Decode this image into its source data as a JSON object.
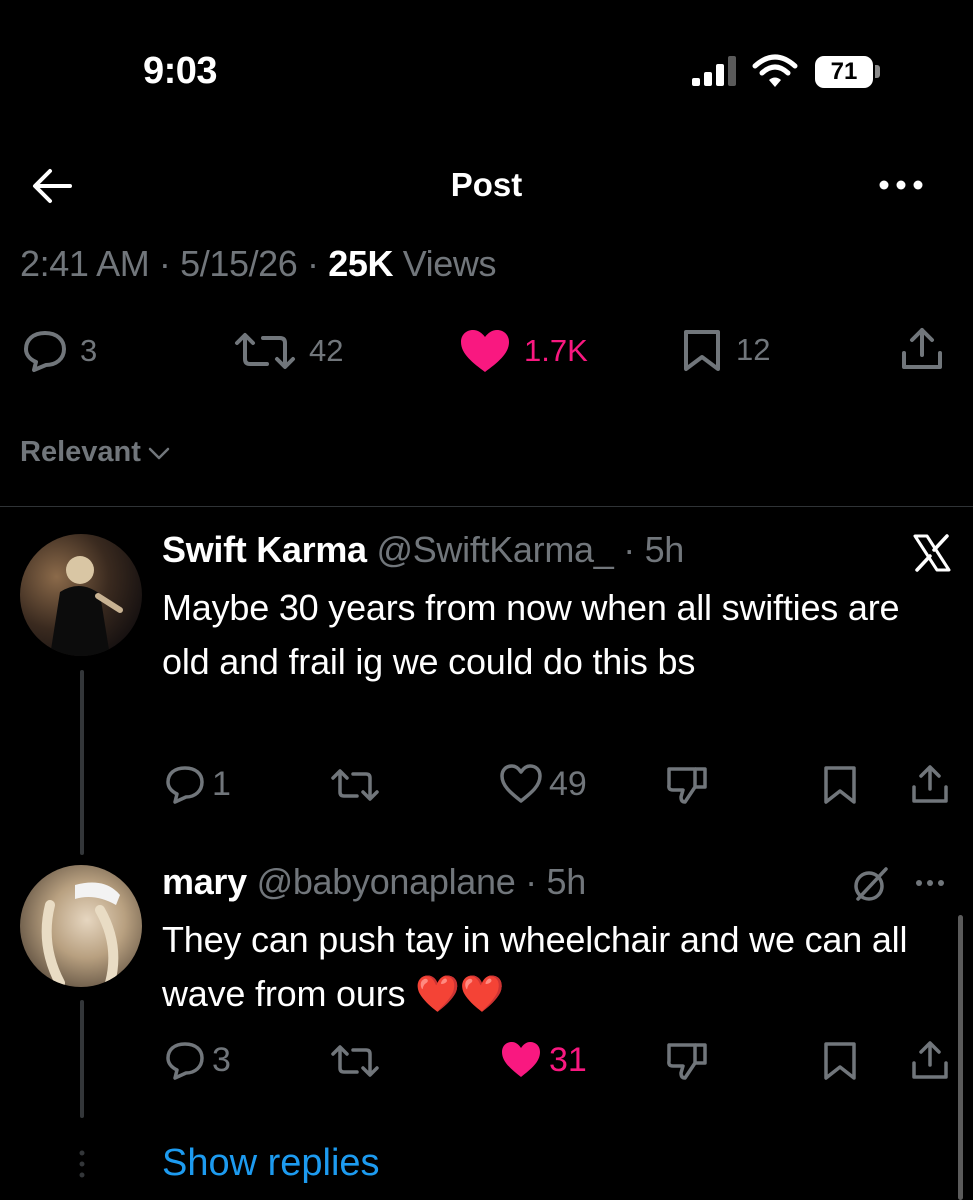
{
  "status_bar": {
    "time": "9:03",
    "battery": "71"
  },
  "header": {
    "title": "Post",
    "back_icon": "arrow-left-icon",
    "more_icon": "more-horizontal-icon"
  },
  "post_meta": {
    "time": "2:41 AM",
    "date": "5/15/26",
    "views_count": "25K",
    "views_label": "Views"
  },
  "post_stats": {
    "replies": "3",
    "reposts": "42",
    "likes": "1.7K",
    "bookmarks": "12",
    "liked": true
  },
  "sort": {
    "label": "Relevant"
  },
  "replies": [
    {
      "name": "Swift Karma",
      "handle": "@SwiftKarma_",
      "age": "5h",
      "text": "Maybe 30 years from now when all swifties are old and frail ig we could do this bs",
      "reply_count": "1",
      "repost_count": "",
      "like_count": "49",
      "liked": false
    },
    {
      "name": "mary",
      "handle": "@babyonaplane",
      "age": "5h",
      "text": "They can push tay in wheelchair and we can all wave from ours ❤️❤️",
      "reply_count": "3",
      "repost_count": "",
      "like_count": "31",
      "liked": true
    }
  ],
  "show_replies": "Show replies",
  "colors": {
    "background": "#000000",
    "text": "#e7e9ea",
    "muted": "#71767b",
    "like_pink": "#f91880",
    "link_blue": "#1d9bf0"
  }
}
